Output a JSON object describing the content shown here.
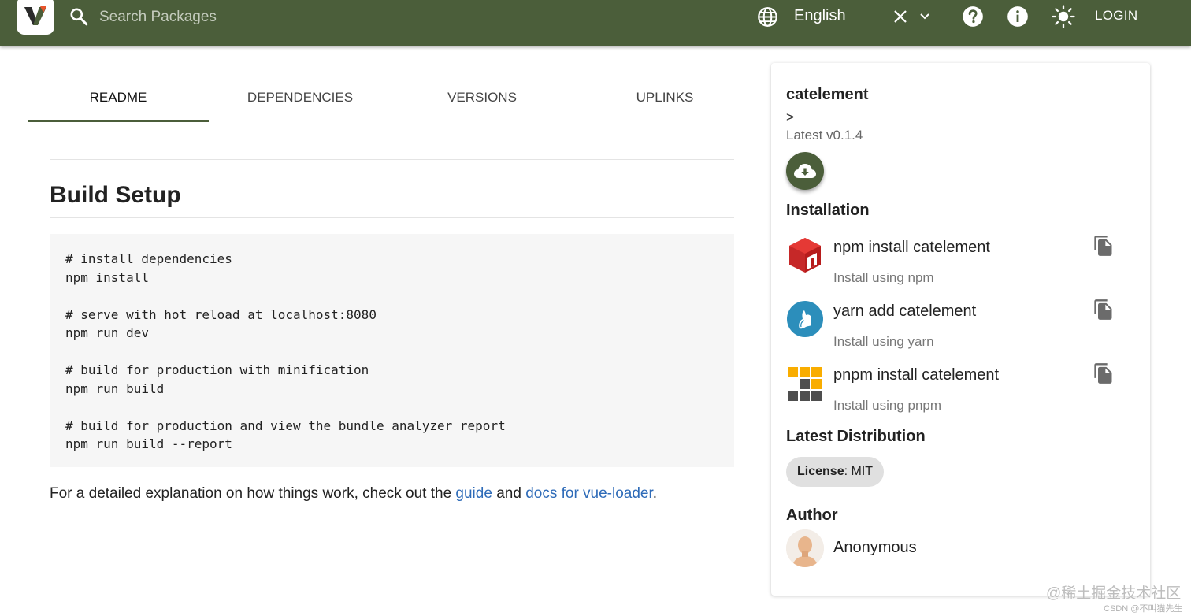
{
  "header": {
    "search_placeholder": "Search Packages",
    "language": "English",
    "login_label": "LOGIN",
    "bar_color": "#4b5e3a",
    "icons": [
      "logo-icon",
      "search-icon",
      "language-icon",
      "clear-icon",
      "chevron-down-icon",
      "help-icon",
      "info-icon",
      "theme-icon"
    ]
  },
  "tabs": [
    {
      "label": "README",
      "active": true
    },
    {
      "label": "DEPENDENCIES",
      "active": false
    },
    {
      "label": "VERSIONS",
      "active": false
    },
    {
      "label": "UPLINKS",
      "active": false
    }
  ],
  "readme": {
    "heading": "Build Setup",
    "code_lines": [
      "# install dependencies",
      "npm install",
      "",
      "# serve with hot reload at localhost:8080",
      "npm run dev",
      "",
      "# build for production with minification",
      "npm run build",
      "",
      "# build for production and view the bundle analyzer report",
      "npm run build --report"
    ],
    "para_prefix": "For a detailed explanation on how things work, check out the ",
    "guide_link": "guide",
    "para_and": " and ",
    "docs_link": "docs for vue-loader",
    "para_suffix": "."
  },
  "sidebar": {
    "package_name": "catelement",
    "arrow": ">",
    "latest_version": "Latest v0.1.4",
    "installation_title": "Installation",
    "installs": [
      {
        "command": "npm install catelement",
        "subtitle": "Install using npm",
        "icon": "npm-icon"
      },
      {
        "command": "yarn add catelement",
        "subtitle": "Install using yarn",
        "icon": "yarn-icon"
      },
      {
        "command": "pnpm install catelement",
        "subtitle": "Install using pnpm",
        "icon": "pnpm-icon"
      }
    ],
    "distribution_title": "Latest Distribution",
    "license_label": "License",
    "license_value": ": MIT",
    "author_title": "Author",
    "author_name": "Anonymous"
  },
  "watermark": {
    "main": "@稀土掘金技术社区",
    "small": "CSDN @不叫猫先生"
  }
}
